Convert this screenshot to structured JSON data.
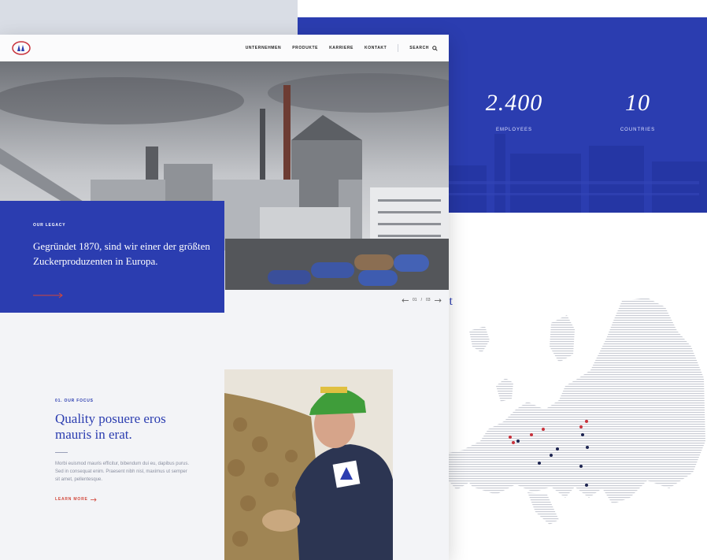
{
  "nav": {
    "items": [
      "UNTERNEHMEN",
      "PRODUKTE",
      "KARRIERE",
      "KONTAKT"
    ],
    "search_label": "SEARCH"
  },
  "hero": {
    "eyebrow": "OUR LEGACY",
    "heading": "Gegründet 1870, sind wir einer der größten Zuckerproduzenten in Europa.",
    "slider_current": "01",
    "slider_total": "03"
  },
  "stats": [
    {
      "value": "2.400",
      "label": "EMPLOYEES"
    },
    {
      "value": "10",
      "label": "COUNTRIES"
    }
  ],
  "partial_heading": "it",
  "focus": {
    "eyebrow": "01. OUR FOCUS",
    "heading": "Quality posuere eros mauris in erat.",
    "body": "Morbi euismod mauris efficitur, bibendum dui eu, dapibus purus. Sed in consequat enim. Praesent nibh nisl, maximus ut semper sit amet, pellentesque.",
    "link": "LEARN MORE"
  },
  "colors": {
    "brand_blue": "#2b3db0",
    "accent_red": "#d2473a",
    "map_dot_red": "#c8323c",
    "map_dot_navy": "#1d2450"
  },
  "icons": [
    "logo-icon",
    "search-icon",
    "arrow-right-icon",
    "arrow-left-icon"
  ]
}
